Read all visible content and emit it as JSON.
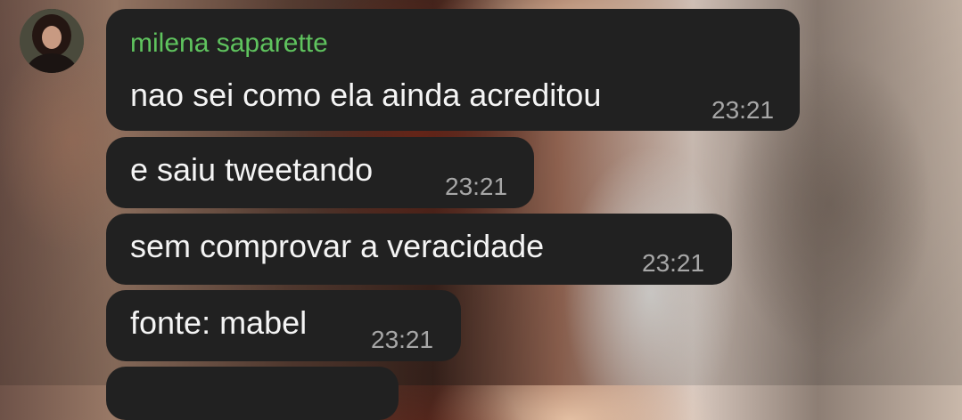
{
  "chat": {
    "sender_name": "milena saparette",
    "messages": [
      {
        "text": "nao sei como ela ainda acreditou",
        "time": "23:21"
      },
      {
        "text": "e saiu tweetando",
        "time": "23:21"
      },
      {
        "text": "sem comprovar a veracidade",
        "time": "23:21"
      },
      {
        "text": "fonte: mabel",
        "time": "23:21"
      }
    ]
  },
  "colors": {
    "bubble": "#212121",
    "sender_name": "#5fc35e",
    "message_text": "#f4f4f4",
    "timestamp": "#a7a7a7"
  }
}
